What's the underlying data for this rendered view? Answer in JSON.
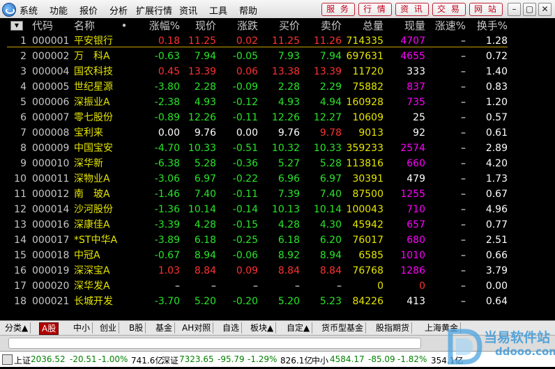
{
  "menu": [
    "系统",
    "功能",
    "报价",
    "分析",
    "扩展行情",
    "资讯",
    "工具",
    "帮助"
  ],
  "site_buttons": [
    "服 务",
    "行 情",
    "资 讯",
    "交 易",
    "网 站"
  ],
  "window_buttons": [
    "–",
    "▢",
    "✕"
  ],
  "table": {
    "headers": [
      "代码",
      "名称",
      "•",
      "涨幅%",
      "现价",
      "涨跌",
      "买价",
      "卖价",
      "总量",
      "现量",
      "涨速%",
      "换手%"
    ],
    "rows": [
      [
        "1",
        "000001",
        "平安银行",
        "0.18",
        "11.25",
        "0.02",
        "11.25",
        "11.26",
        "714335",
        "4707",
        "–",
        "1.28"
      ],
      [
        "2",
        "000002",
        "万　科A",
        "-0.63",
        "7.94",
        "-0.05",
        "7.93",
        "7.94",
        "697631",
        "4655",
        "–",
        "0.72"
      ],
      [
        "3",
        "000004",
        "国农科技",
        "0.45",
        "13.39",
        "0.06",
        "13.38",
        "13.39",
        "11720",
        "333",
        "–",
        "1.40"
      ],
      [
        "4",
        "000005",
        "世纪星源",
        "-3.80",
        "2.28",
        "-0.09",
        "2.28",
        "2.29",
        "75882",
        "837",
        "–",
        "0.83"
      ],
      [
        "5",
        "000006",
        "深振业A",
        "-2.38",
        "4.93",
        "-0.12",
        "4.93",
        "4.94",
        "160928",
        "735",
        "–",
        "1.20"
      ],
      [
        "6",
        "000007",
        "零七股份",
        "-0.89",
        "12.26",
        "-0.11",
        "12.26",
        "12.27",
        "10609",
        "25",
        "–",
        "0.57"
      ],
      [
        "7",
        "000008",
        "宝利来",
        "0.00",
        "9.76",
        "0.00",
        "9.76",
        "9.78",
        "9013",
        "92",
        "–",
        "0.61"
      ],
      [
        "8",
        "000009",
        "中国宝安",
        "-4.70",
        "10.33",
        "-0.51",
        "10.32",
        "10.33",
        "359233",
        "2574",
        "–",
        "2.89"
      ],
      [
        "9",
        "000010",
        "深华新",
        "-6.38",
        "5.28",
        "-0.36",
        "5.27",
        "5.28",
        "113816",
        "660",
        "–",
        "4.20"
      ],
      [
        "10",
        "000011",
        "深物业A",
        "-3.06",
        "6.97",
        "-0.22",
        "6.96",
        "6.97",
        "30391",
        "479",
        "–",
        "1.73"
      ],
      [
        "11",
        "000012",
        "南　玻A",
        "-1.46",
        "7.40",
        "-0.11",
        "7.39",
        "7.40",
        "87500",
        "1255",
        "–",
        "0.67"
      ],
      [
        "12",
        "000014",
        "沙河股份",
        "-1.36",
        "10.14",
        "-0.14",
        "10.13",
        "10.14",
        "100043",
        "710",
        "–",
        "4.96"
      ],
      [
        "13",
        "000016",
        "深康佳A",
        "-3.39",
        "4.28",
        "-0.15",
        "4.28",
        "4.30",
        "45942",
        "657",
        "–",
        "0.77"
      ],
      [
        "14",
        "000017",
        "*ST中华A",
        "-3.89",
        "6.18",
        "-0.25",
        "6.18",
        "6.20",
        "76017",
        "680",
        "–",
        "2.51"
      ],
      [
        "15",
        "000018",
        "中冠A",
        "-0.67",
        "8.94",
        "-0.06",
        "8.92",
        "8.94",
        "6585",
        "1010",
        "–",
        "0.66"
      ],
      [
        "16",
        "000019",
        "深深宝A",
        "1.03",
        "8.84",
        "0.09",
        "8.84",
        "8.84",
        "76768",
        "1286",
        "–",
        "3.79"
      ],
      [
        "17",
        "000020",
        "深华发A",
        "–",
        "–",
        "–",
        "–",
        "–",
        "0",
        "0",
        "–",
        "0.00"
      ],
      [
        "18",
        "000021",
        "长城开发",
        "-3.70",
        "5.20",
        "-0.20",
        "5.20",
        "5.23",
        "84226",
        "413",
        "–",
        "0.64"
      ]
    ]
  },
  "tabs": [
    "分类▲",
    "A股",
    "中小",
    "创业",
    "B股",
    "基金",
    "AH对照",
    "自选",
    "板块▲",
    "自定▲",
    "货币型基金",
    "股指期货",
    "上海黄金"
  ],
  "status": {
    "sh_label": "上证",
    "sh_value": "2036.52",
    "sh_change": "-20.51",
    "sh_pct": "-1.00%",
    "sh_amount": "741.6亿",
    "sz_label": "深证",
    "sz_value": "7323.65",
    "sz_change": "-95.79",
    "sz_pct": "-1.29%",
    "sz_amount": "826.1亿",
    "zx_label": "中小",
    "zx_value": "4584.17",
    "zx_change": "-85.09",
    "zx_pct": "-1.82%",
    "zx_amount": "354.1亿"
  },
  "watermark": {
    "line1": "当易软件站",
    "line2": "ddooo.com"
  },
  "colors": {
    "up": "#ff3232",
    "down": "#28e628",
    "flat": "#ffffff",
    "name": "#e6e600",
    "volume": "#e6e600",
    "nowvol_up": "#ff00ff",
    "index_bg": "#000"
  }
}
